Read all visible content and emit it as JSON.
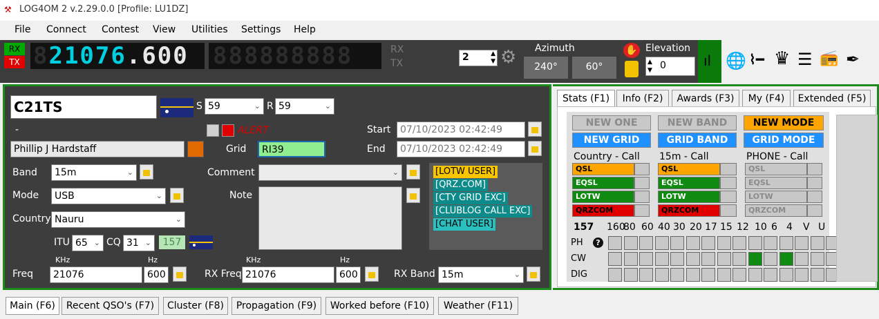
{
  "window": {
    "title": "LOG4OM 2 v.2.29.0.0 [Profile: LU1DZ]"
  },
  "menu": [
    "File",
    "Connect",
    "Contest",
    "View",
    "Utilities",
    "Settings",
    "Help"
  ],
  "radio": {
    "rx_label": "RX",
    "tx_label": "TX",
    "frequency_display": "21076.600",
    "vfo_b_display": "888888888",
    "rx_side": "RX",
    "tx_side": "TX",
    "spinner_value": "2"
  },
  "rotator": {
    "azimuth_label": "Azimuth",
    "azimuth_value": "240°",
    "second_value": "60°",
    "elevation_label": "Elevation",
    "elevation_value": "0"
  },
  "qso": {
    "callsign": "C21TS",
    "s_label": "S",
    "s_report": "59",
    "r_label": "R",
    "r_report": "59",
    "dash": "-",
    "alert": "ALERT",
    "start_label": "Start",
    "start_value": "07/10/2023 02:42:49",
    "end_label": "End",
    "end_value": "07/10/2023 02:42:49",
    "name": "Phillip J Hardstaff",
    "grid_label": "Grid",
    "grid_value": "RI39",
    "band_label": "Band",
    "band_value": "15m",
    "comment_label": "Comment",
    "comment_value": "",
    "mode_label": "Mode",
    "mode_value": "USB",
    "note_label": "Note",
    "note_value": "",
    "country_label": "Country",
    "country_value": "Nauru",
    "itu_label": "ITU",
    "itu_value": "65",
    "cq_label": "CQ",
    "cq_value": "31",
    "dxcc_value": "157",
    "khz_label": "KHz",
    "hz_label": "Hz",
    "freq_label": "Freq",
    "freq_khz": "21076",
    "freq_hz": "600",
    "rxfreq_label": "RX Freq",
    "rxfreq_khz": "21076",
    "rxfreq_hz": "600",
    "rxband_label": "RX Band",
    "rxband_value": "15m",
    "tags": [
      "[LOTW USER]",
      "[QRZ.COM]",
      "[CTY GRID EXC]",
      "[CLUBLOG CALL EXC]",
      "[CHAT USER]"
    ]
  },
  "right_tabs": [
    "Stats (F1)",
    "Info (F2)",
    "Awards (F3)",
    "My (F4)",
    "Extended (F5)"
  ],
  "stats": {
    "new_one": "NEW ONE",
    "new_band": "NEW BAND",
    "new_mode": "NEW MODE",
    "new_grid": "NEW GRID",
    "grid_band": "GRID BAND",
    "grid_mode": "GRID MODE",
    "col1_header": "Country - Call",
    "col2_header": "15m - Call",
    "col3_header": "PHONE - Call",
    "rows": [
      "QSL",
      "EQSL",
      "LOTW",
      "QRZCOM"
    ],
    "dxcc": "157",
    "bands": [
      "160",
      "80",
      "60",
      "40",
      "30",
      "20",
      "17",
      "15",
      "12",
      "10",
      "6",
      "4",
      "V",
      "U"
    ],
    "row_labels": [
      "PH",
      "CW",
      "DIG"
    ],
    "help_icon": "?"
  },
  "bottom_tabs": [
    "Main (F6)",
    "Recent QSO's (F7)",
    "Cluster (F8)",
    "Propagation (F9)",
    "Worked before (F10)",
    "Weather (F11)"
  ],
  "colors": {
    "lcd_cyan": "#00cfe0",
    "panel_green": "#1d8a1d",
    "alert_red": "#e00000",
    "tag_yellow": "#f7c600",
    "tag_teal": "#0d8a8a",
    "new_mode_orange": "#ffa500",
    "blue_btn": "#1e90ff"
  }
}
